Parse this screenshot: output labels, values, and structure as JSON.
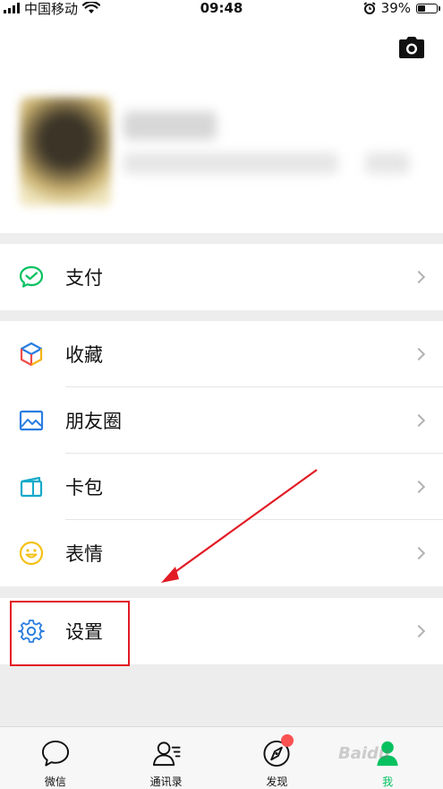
{
  "status_bar": {
    "carrier": "中国移动",
    "time": "09:48",
    "battery": "39%",
    "battery_level": 0.39
  },
  "profile": {
    "camera_icon": "camera-icon"
  },
  "menu": {
    "pay": {
      "label": "支付",
      "icon": "wechat-pay-icon",
      "color": "#07c160"
    },
    "favorites": {
      "label": "收藏",
      "icon": "cube-icon"
    },
    "moments": {
      "label": "朋友圈",
      "icon": "image-icon",
      "color": "#2a7de1"
    },
    "cards": {
      "label": "卡包",
      "icon": "card-wallet-icon",
      "color": "#14a9c9"
    },
    "stickers": {
      "label": "表情",
      "icon": "smiley-icon",
      "color": "#f5c116"
    },
    "settings": {
      "label": "设置",
      "icon": "gear-icon",
      "color": "#2a7de1"
    }
  },
  "tabs": [
    {
      "label": "微信",
      "icon": "chat-bubble-icon",
      "active": false
    },
    {
      "label": "通讯录",
      "icon": "contacts-icon",
      "active": false
    },
    {
      "label": "发现",
      "icon": "compass-icon",
      "active": false,
      "badge": true
    },
    {
      "label": "我",
      "icon": "person-icon",
      "active": true
    }
  ],
  "colors": {
    "accent": "#07c160",
    "annotation": "#e21b25",
    "badge": "#fa5151"
  }
}
